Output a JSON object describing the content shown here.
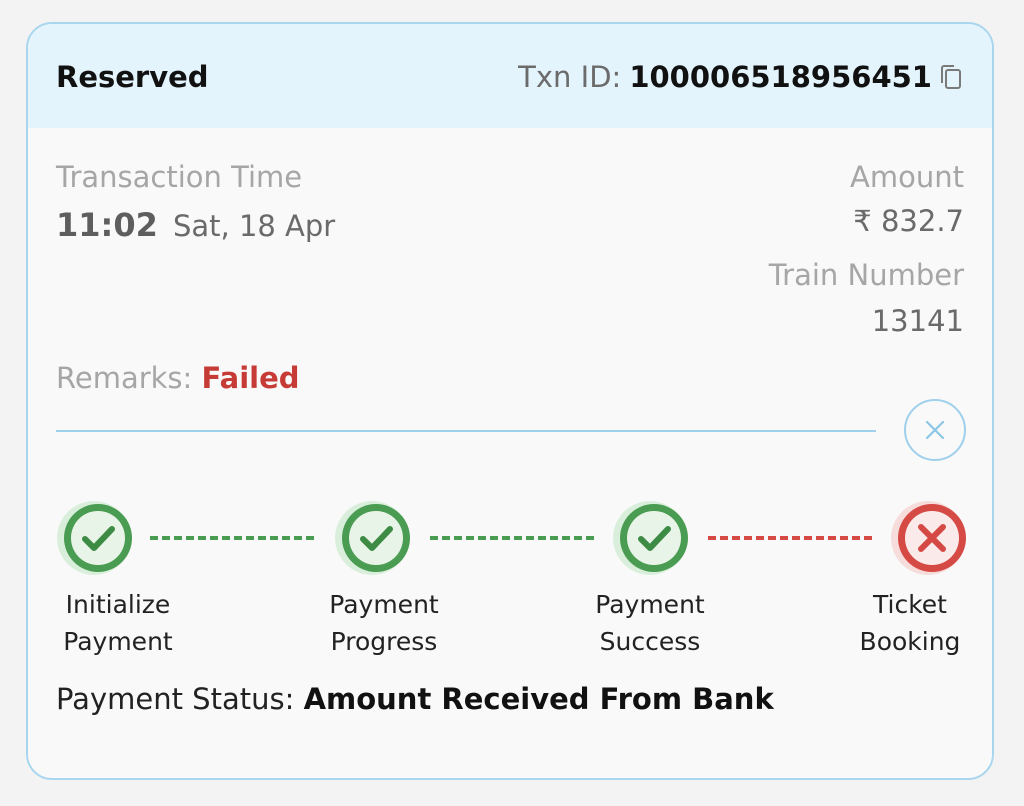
{
  "header": {
    "status": "Reserved",
    "txn_label": "Txn ID:",
    "txn_id": "100006518956451"
  },
  "details": {
    "transaction_time_label": "Transaction Time",
    "time": "11:02",
    "date": "Sat, 18 Apr",
    "amount_label": "Amount",
    "amount": "₹ 832.7",
    "train_number_label": "Train Number",
    "train_number": "13141",
    "remarks_label": "Remarks:",
    "remarks_value": "Failed"
  },
  "steps": [
    {
      "line1": "Initialize",
      "line2": "Payment",
      "state": "success"
    },
    {
      "line1": "Payment",
      "line2": "Progress",
      "state": "success"
    },
    {
      "line1": "Payment",
      "line2": "Success",
      "state": "success"
    },
    {
      "line1": "Ticket",
      "line2": "Booking",
      "state": "failed"
    }
  ],
  "payment_status": {
    "label": "Payment Status:",
    "value": "Amount Received From Bank"
  },
  "colors": {
    "success": "#4a9c52",
    "failed": "#d64a45",
    "accent": "#9fd0ec",
    "header_bg": "#e4f4fd"
  },
  "icons": {
    "copy": "copy-icon",
    "close": "close-icon",
    "success": "check-circle-icon",
    "failed": "x-circle-icon"
  }
}
